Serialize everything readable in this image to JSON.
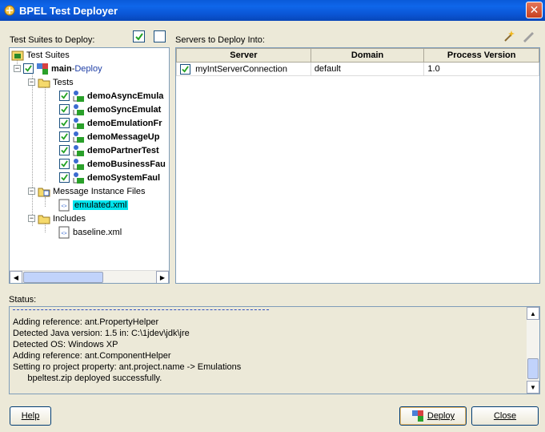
{
  "window": {
    "title": "BPEL Test Deployer"
  },
  "left": {
    "label": "Test Suites to Deploy:",
    "tree": {
      "root": "Test Suites",
      "main_name": "main",
      "main_sep": " - ",
      "main_link": "Deploy",
      "tests_folder": "Tests",
      "tests": [
        "demoAsyncEmula",
        "demoSyncEmulat",
        "demoEmulationFr",
        "demoMessageUp",
        "demoPartnerTest",
        "demoBusinessFau",
        "demoSystemFaul"
      ],
      "message_folder": "Message Instance Files",
      "message_file": "emulated.xml",
      "includes_folder": "Includes",
      "include_file": "baseline.xml"
    }
  },
  "right": {
    "label": "Servers to Deploy Into:",
    "columns": [
      "Server",
      "Domain",
      "Process Version"
    ],
    "rows": [
      {
        "server": "myIntServerConnection",
        "domain": "default",
        "version": "1.0"
      }
    ]
  },
  "status": {
    "label": "Status:",
    "lines": [
      "Adding reference: ant.PropertyHelper",
      "Detected Java version: 1.5 in: C:\\1jdev\\jdk\\jre",
      "Detected OS: Windows XP",
      "Adding reference: ant.ComponentHelper",
      "Setting ro project property: ant.project.name -> Emulations",
      "      bpeltest.zip deployed successfully."
    ]
  },
  "buttons": {
    "help": "Help",
    "deploy": "Deploy",
    "close": "Close"
  },
  "colors": {
    "selection": "#00e5ee",
    "titlebar": "#0a5ad9"
  }
}
